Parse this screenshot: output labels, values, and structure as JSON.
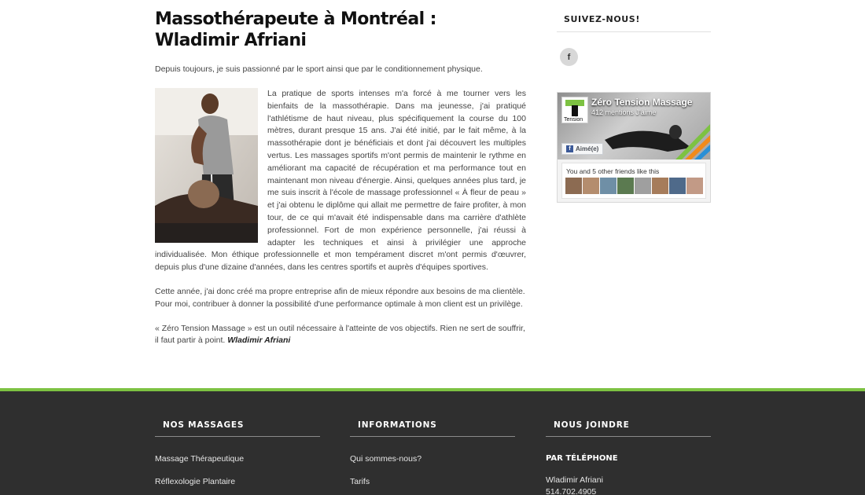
{
  "article": {
    "title_line1": "Massothérapeute à Montréal :",
    "title_line2": "Wladimir Afriani",
    "intro": "Depuis toujours, je suis passionné par le sport ainsi que par le conditionnement physique.",
    "bio": "La pratique de sports intenses m'a forcé à me tourner vers les bienfaits de la massothérapie. Dans ma jeunesse, j'ai pratiqué l'athlétisme de haut niveau, plus spécifiquement la course du 100 mètres, durant presque 15 ans. J'ai été initié, par le fait même, à la massothérapie dont je bénéficiais et dont j'ai découvert les multiples vertus. Les massages sportifs m'ont permis de maintenir le rythme en améliorant ma capacité de récupération et ma performance tout en maintenant mon niveau d'énergie. Ainsi, quelques années plus tard, je me suis inscrit à l'école de massage professionnel « À fleur de peau » et j'ai obtenu le diplôme qui allait me permettre de faire profiter, à mon tour, de ce qui m'avait été indispensable dans ma carrière d'athlète professionnel. Fort de mon expérience personnelle, j'ai réussi à adapter les techniques et ainsi à privilégier une approche individualisée. Mon éthique professionnelle et mon tempérament discret m'ont permis d'œuvrer, depuis plus d'une dizaine d'années, dans les centres sportifs et auprès d'équipes sportives.",
    "para2": "Cette année, j'ai donc créé ma propre entreprise afin de mieux répondre aux besoins de ma clientèle. Pour moi, contribuer à donner la possibilité d'une performance optimale à mon client est un privilège.",
    "para3": "« Zéro Tension Massage » est un outil nécessaire à l'atteinte de vos objectifs. Rien ne sert de souffrir, il faut partir à point.",
    "signature": "Wladimir Afriani"
  },
  "sidebar": {
    "follow_title": "SUIVEZ-NOUS!",
    "facebook_icon": "facebook-icon",
    "fb_page_name": "Zéro Tension Massage",
    "fb_likes": "412 mentions J'aime",
    "fb_liked_button": "Aimé(e)",
    "fb_logo_text": "Tension",
    "fb_friends_text": "You and 5 other friends like this"
  },
  "footer": {
    "col1": {
      "title": "NOS MASSAGES",
      "links": [
        "Massage Thérapeutique",
        "Réflexologie Plantaire"
      ]
    },
    "col2": {
      "title": "INFORMATIONS",
      "links": [
        "Qui sommes-nous?",
        "Tarifs"
      ]
    },
    "col3": {
      "title": "NOUS JOINDRE",
      "subtitle": "PAR TÉLÉPHONE",
      "contact_name": "Wladimir Afriani",
      "phone": "514.702.4905"
    }
  },
  "colors": {
    "accent_green": "#7dc242",
    "footer_bg": "#2f2f2f",
    "facebook_blue": "#3b5998"
  }
}
